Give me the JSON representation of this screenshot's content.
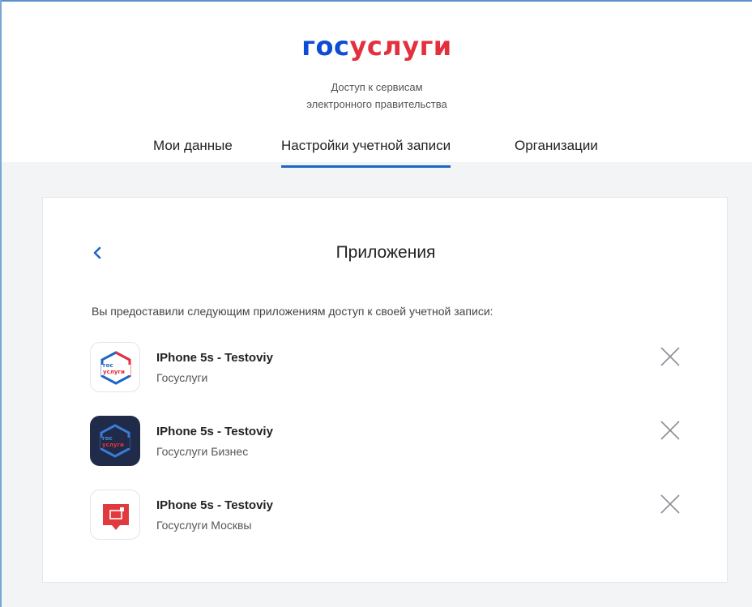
{
  "header": {
    "logo": {
      "part1": "гос",
      "part2": "услуги"
    },
    "tagline": {
      "line1": "Доступ к сервисам",
      "line2": "электронного правительства"
    },
    "tabs": [
      {
        "label": "Мои данные",
        "active": false
      },
      {
        "label": "Настройки учетной записи",
        "active": true
      },
      {
        "label": "Организации",
        "active": false
      }
    ]
  },
  "card": {
    "title": "Приложения",
    "intro": "Вы предоставили следующим приложениям доступ к своей учетной записи:",
    "apps": [
      {
        "name": "IPhone 5s - Testoviy",
        "service": "Госуслуги",
        "icon": "gosuslugi-app-icon"
      },
      {
        "name": "IPhone 5s - Testoviy",
        "service": "Госуслуги Бизнес",
        "icon": "gosuslugi-business-app-icon"
      },
      {
        "name": "IPhone 5s - Testoviy",
        "service": "Госуслуги Москвы",
        "icon": "gosuslugi-moscow-app-icon"
      }
    ]
  },
  "colors": {
    "accent": "#1e66c6",
    "brand_blue": "#0d4cd3",
    "brand_red": "#e3303d"
  }
}
